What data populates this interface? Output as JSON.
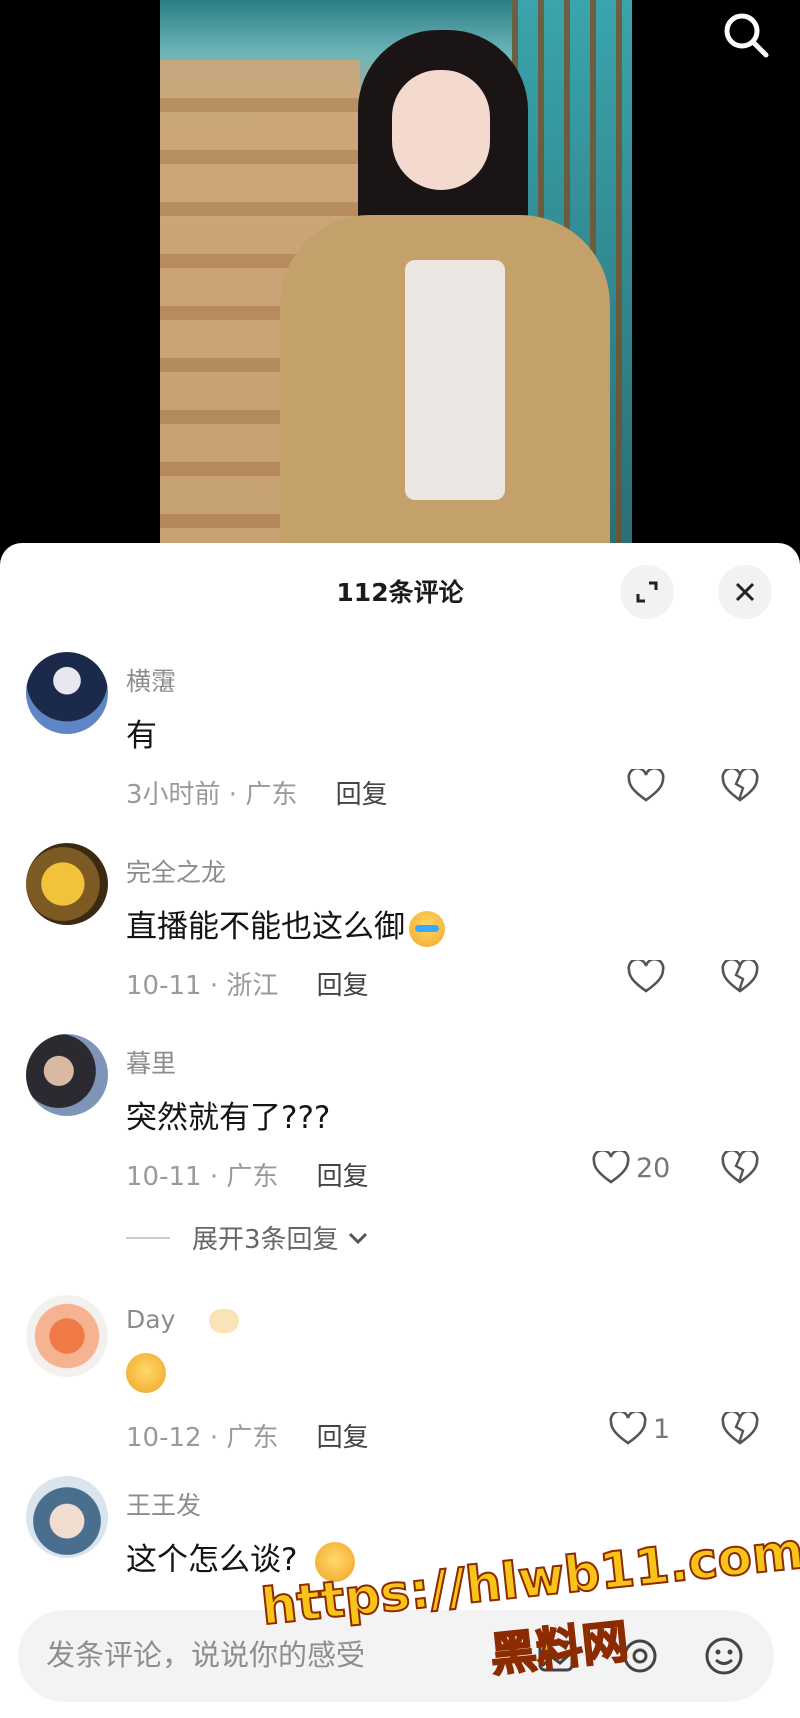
{
  "header": {
    "comment_count_title": "112条评论"
  },
  "comments": [
    {
      "user": "横霮",
      "text": "有",
      "time_loc": "3小时前 · 广东",
      "reply": "回复",
      "likes": ""
    },
    {
      "user": "完全之龙",
      "text": "直播能不能也这么御",
      "time_loc": "10-11 · 浙江",
      "reply": "回复",
      "likes": ""
    },
    {
      "user": "暮里",
      "text": "突然就有了???",
      "time_loc": "10-11 · 广东",
      "reply": "回复",
      "likes": "20"
    },
    {
      "user": "Day",
      "text": "",
      "time_loc": "10-12 · 广东",
      "reply": "回复",
      "likes": "1"
    },
    {
      "user": "王王发",
      "text": "这个怎么谈?",
      "time_loc": "",
      "reply": "",
      "likes": ""
    }
  ],
  "expand_replies": "展开3条回复",
  "input": {
    "placeholder": "发条评论，说说你的感受"
  },
  "watermark": {
    "url": "https://hlwb11.com",
    "name": "黑料网"
  },
  "colors": {
    "sheet_bg": "#ffffff",
    "muted_text": "#8c8c8c",
    "text": "#141414"
  }
}
